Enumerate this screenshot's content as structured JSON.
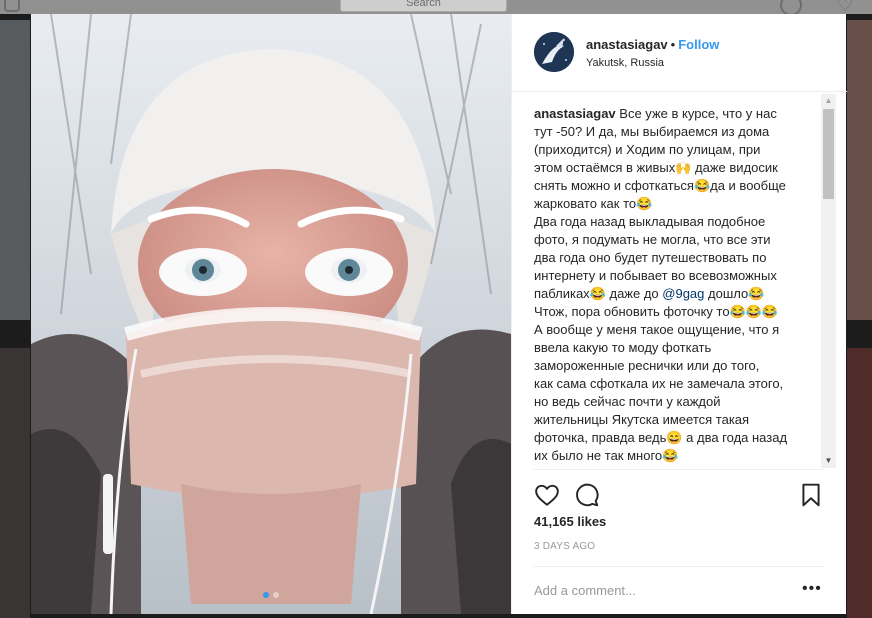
{
  "background": {
    "search_placeholder": "Search"
  },
  "post": {
    "username": "anastasiagav",
    "separator": "•",
    "follow_label": "Follow",
    "location": "Yakutsk, Russia",
    "caption_username": "anastasiagav",
    "caption_lines": [
      "Все уже в курсе, что у нас",
      "тут -50? И да, мы выбираемся из дома",
      "(приходится) и Ходим по улицам, при",
      "этом остаёмся в живых🙌 даже видосик",
      "снять можно и сфоткаться😂да и вообще",
      "жарковато как то😂",
      "Два года назад выкладывая подобное",
      "фото, я подумать не могла, что все эти",
      "два года оно будет путешествовать по",
      "интернету и побывает во всевозможных",
      "пабликах😂 даже до "
    ],
    "mention": "@9gag",
    "caption_lines_after": [
      " дошло😂",
      "Чтож, пора обновить фоточку то😂😂😂",
      "А вообще у меня такое ощущение, что я",
      "ввела какую то моду фоткать",
      "замороженные реснички или до того,",
      "как сама сфоткала их не замечала этого,",
      "но ведь сейчас почти у каждой",
      "жительницы Якутска имеется такая",
      "фоточка, правда ведь😄 а два года назад",
      "их было не так много😂"
    ],
    "likes": "41,165 likes",
    "timestamp": "3 DAYS AGO",
    "comment_placeholder": "Add a comment...",
    "more_label": "•••",
    "carousel": {
      "count": 2,
      "active_index": 0
    }
  },
  "icons": {
    "like": "heart-icon",
    "comment": "comment-icon",
    "save": "bookmark-icon",
    "scroll_up": "▲",
    "scroll_down": "▼"
  },
  "colors": {
    "accent": "#3897f0",
    "text": "#262626",
    "muted": "#999999",
    "border": "#efefef"
  }
}
